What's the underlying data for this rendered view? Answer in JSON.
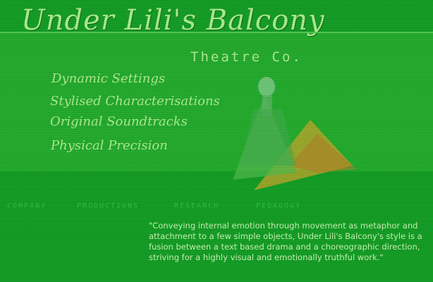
{
  "header": {
    "title": "Under Lili's Balcony",
    "subtitle": "Theatre Co."
  },
  "features": [
    "Dynamic Settings",
    "Stylised Characterisations",
    "Original Soundtracks",
    "Physical Precision"
  ],
  "nav": {
    "items": [
      "COMPANY",
      "PRODUCTIONS",
      "RESEARCH",
      "PEDAGOGY"
    ]
  },
  "quote": "\"Conveying internal emotion through movement as metaphor and attachment to a few simple objects, Under Lili's Balcony's style is a fusion between a text based drama and a choreographic direction, striving for a highly visual and emotionally truthful work.\""
}
